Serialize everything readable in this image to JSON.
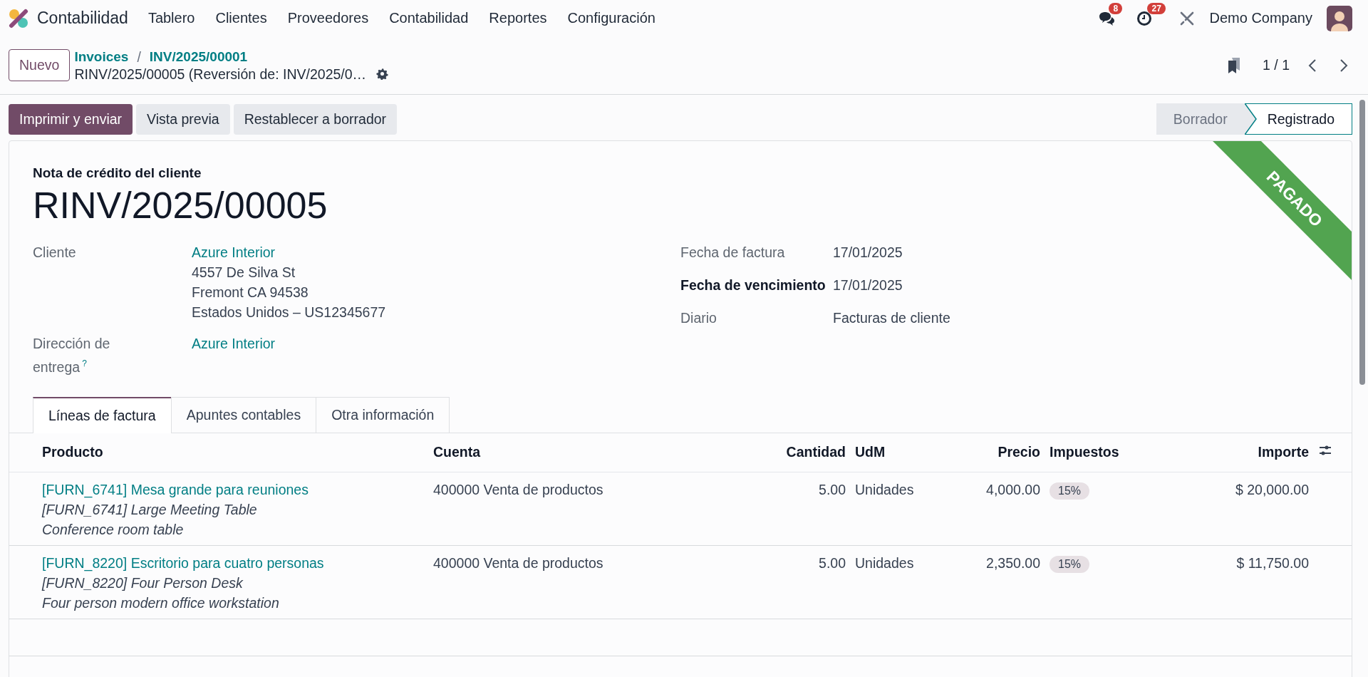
{
  "navbar": {
    "app_name": "Contabilidad",
    "menu": [
      "Tablero",
      "Clientes",
      "Proveedores",
      "Contabilidad",
      "Reportes",
      "Configuración"
    ],
    "messages_count": "8",
    "activities_count": "27",
    "company": "Demo Company"
  },
  "control_panel": {
    "new_button": "Nuevo",
    "breadcrumbs": [
      "Invoices",
      "INV/2025/00001"
    ],
    "breadcrumb_separator": "/",
    "record_title": "RINV/2025/00005 (Reversión de: INV/2025/0…",
    "pager": "1 / 1"
  },
  "actions": [
    {
      "label": "Imprimir y enviar",
      "kind": "primary"
    },
    {
      "label": "Vista previa",
      "kind": "secondary"
    },
    {
      "label": "Restablecer a borrador",
      "kind": "secondary"
    }
  ],
  "status_bar": [
    {
      "label": "Borrador",
      "selected": false
    },
    {
      "label": "Registrado",
      "selected": true
    }
  ],
  "sheet": {
    "document_type": "Nota de crédito del cliente",
    "number": "RINV/2025/00005",
    "ribbon": "PAGADO",
    "left_fields": [
      {
        "label": "Cliente",
        "link": "Azure Interior",
        "lines": [
          "4557 De Silva St",
          "Fremont CA 94538",
          "Estados Unidos – US12345677"
        ]
      },
      {
        "label": "Dirección de entrega",
        "help": "?",
        "link": "Azure Interior"
      }
    ],
    "right_fields": [
      {
        "label": "Fecha de factura",
        "value": "17/01/2025",
        "required": false
      },
      {
        "label": "Fecha de vencimiento",
        "value": "17/01/2025",
        "required": true
      },
      {
        "label": "Diario",
        "value": "Facturas de cliente",
        "required": false
      }
    ],
    "tabs": [
      {
        "label": "Líneas de factura",
        "selected": true
      },
      {
        "label": "Apuntes contables",
        "selected": false
      },
      {
        "label": "Otra información",
        "selected": false
      }
    ],
    "table": {
      "columns": [
        {
          "label": "Producto",
          "kind": "text"
        },
        {
          "label": "Cuenta",
          "kind": "text"
        },
        {
          "label": "Cantidad",
          "kind": "number"
        },
        {
          "label": "UdM",
          "kind": "text"
        },
        {
          "label": "Precio",
          "kind": "number"
        },
        {
          "label": "Impuestos",
          "kind": "text"
        },
        {
          "label": "Importe",
          "kind": "number"
        }
      ],
      "rows": [
        {
          "product": "[FURN_6741] Mesa grande para reuniones",
          "description": [
            "[FURN_6741] Large Meeting Table",
            "Conference room table"
          ],
          "account": "400000 Venta de productos",
          "quantity": "5.00",
          "uom": "Unidades",
          "price": "4,000.00",
          "taxes": [
            "15%"
          ],
          "amount": "$ 20,000.00"
        },
        {
          "product": "[FURN_8220] Escritorio para cuatro personas",
          "description": [
            "[FURN_8220] Four Person Desk",
            "Four person modern office workstation"
          ],
          "account": "400000 Venta de productos",
          "quantity": "5.00",
          "uom": "Unidades",
          "price": "2,350.00",
          "taxes": [
            "15%"
          ],
          "amount": "$ 11,750.00"
        }
      ]
    }
  }
}
